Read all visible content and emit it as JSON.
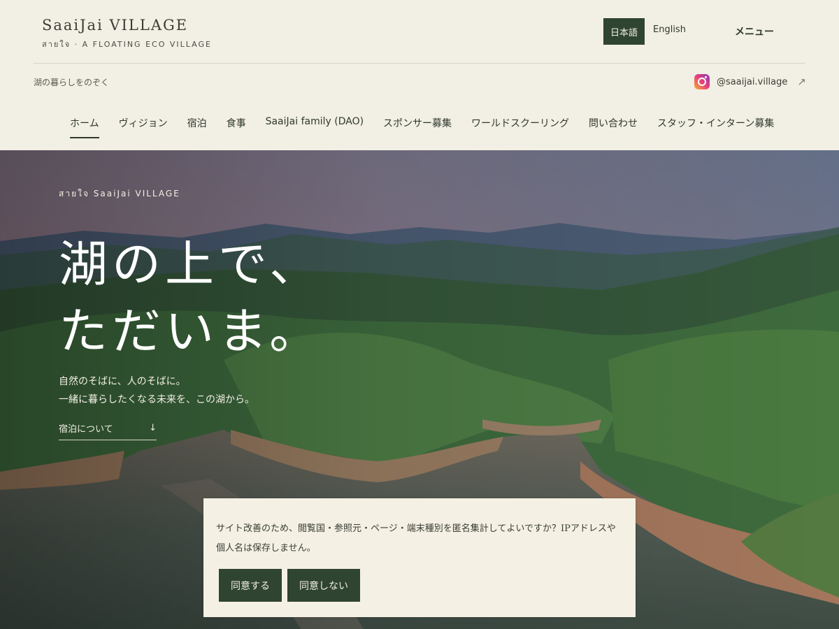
{
  "brand": {
    "title": "SaaiJai VILLAGE",
    "subtitle": "สายใจ · A FLOATING ECO VILLAGE"
  },
  "header": {
    "lang_ja": "日本語",
    "lang_en": "English",
    "menu": "メニュー",
    "tagline": "湖の暮らしをのぞく",
    "instagram_handle": "@saaijai.village",
    "instagram_arrow": "↗"
  },
  "nav": {
    "items": [
      {
        "label": "ホーム",
        "active": true
      },
      {
        "label": "ヴィジョン"
      },
      {
        "label": "宿泊"
      },
      {
        "label": "食事"
      },
      {
        "label": "SaaiJai family (DAO)"
      },
      {
        "label": "スポンサー募集"
      },
      {
        "label": "ワールドスクーリング"
      },
      {
        "label": "問い合わせ"
      },
      {
        "label": "スタッフ・インターン募集"
      }
    ]
  },
  "hero": {
    "eyebrow": "สายใจ   SaaiJai VILLAGE",
    "title_line1": "湖の上で、",
    "title_line2": "ただいま。",
    "lede_line1": "自然のそばに、人のそばに。",
    "lede_line2": "一緒に暮らしたくなる未来を、この湖から。",
    "link_label": "宿泊について",
    "link_arrow": "↓"
  },
  "consent": {
    "text": "サイト改善のため、閲覧国・参照元・ページ・端末種別を匿名集計してよいですか？IPアドレスや個人名は保存しません。",
    "agree": "同意する",
    "decline": "同意しない"
  },
  "colors": {
    "background": "#f2efe4",
    "accent": "#2f4431",
    "text": "#2f3a2c"
  }
}
